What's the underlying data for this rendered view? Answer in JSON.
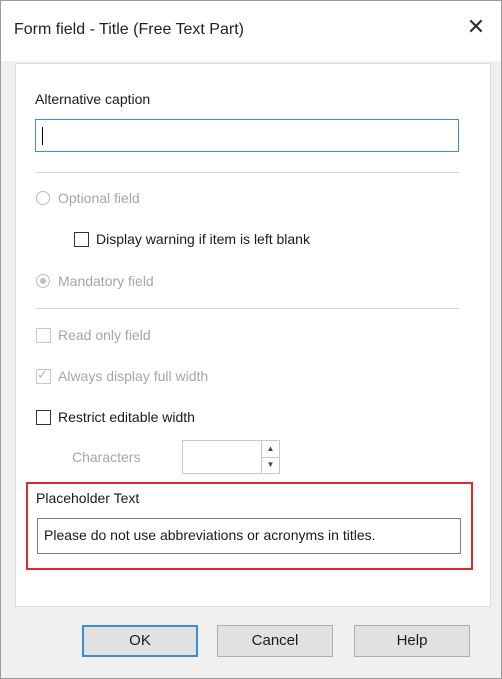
{
  "dialog": {
    "title": "Form field - Title (Free Text Part)",
    "close_icon": "close-icon"
  },
  "alt_caption": {
    "label": "Alternative caption",
    "value": ""
  },
  "options": {
    "optional_field": {
      "label": "Optional field",
      "checked": false,
      "enabled": false
    },
    "display_warning": {
      "label": "Display warning if item is left blank",
      "checked": false,
      "enabled": true
    },
    "mandatory_field": {
      "label": "Mandatory field",
      "checked": true,
      "enabled": false
    },
    "read_only": {
      "label": "Read only field",
      "checked": false,
      "enabled": false
    },
    "full_width": {
      "label": "Always display full width",
      "checked": true,
      "enabled": false
    },
    "restrict_width": {
      "label": "Restrict editable width",
      "checked": false,
      "enabled": true
    },
    "characters": {
      "label": "Characters",
      "value": ""
    }
  },
  "placeholder": {
    "label": "Placeholder Text",
    "value": "Please do not use abbreviations or acronyms in titles.",
    "highlight_color": "#e0282e"
  },
  "buttons": {
    "ok": "OK",
    "cancel": "Cancel",
    "help": "Help"
  },
  "colors": {
    "accent": "#3b8fd6",
    "disabled_text": "#a6a6a6"
  }
}
